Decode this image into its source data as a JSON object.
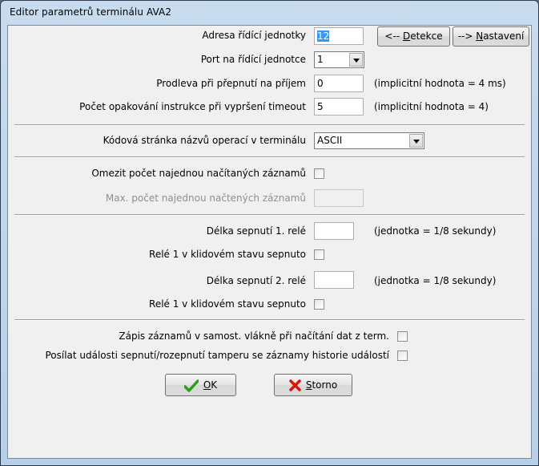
{
  "window": {
    "title": "Editor parametrů terminálu AVA2"
  },
  "fields": {
    "address_label": "Adresa řídící jednotky",
    "address_value": "12",
    "detect_prefix": "<-- ",
    "detect_key": "D",
    "detect_rest": "etekce",
    "setup_prefix": "--> ",
    "setup_key": "N",
    "setup_rest": "astavení",
    "port_label": "Port na řídící jednotce",
    "port_value": "1",
    "delay_label": "Prodleva při přepnutí na příjem",
    "delay_value": "0",
    "delay_note": "(implicitní hodnota = 4 ms)",
    "retry_label": "Počet opakování instrukce při vypršení timeout",
    "retry_value": "5",
    "retry_note": "(implicitní hodnota = 4)",
    "codepage_label": "Kódová stránka názvů operací v terminálu",
    "codepage_value": "ASCII",
    "limit_label": "Omezit počet najednou načítaných záznamů",
    "max_label": "Max. počet najednou načtených záznamů",
    "max_value": "",
    "relay1_label": "Délka sepnutí 1. relé",
    "relay1_value": "",
    "relay1_note": "(jednotka = 1/8 sekundy)",
    "relay1_idle_label": "Relé 1 v klidovém stavu sepnuto",
    "relay2_label": "Délka sepnutí 2. relé",
    "relay2_value": "",
    "relay2_note": "(jednotka = 1/8 sekundy)",
    "relay2_idle_label": "Relé 1 v klidovém stavu sepnuto",
    "thread_label": "Zápis záznamů v samost. vlákně při načítání dat z term.",
    "tamper_label": "Posílat události sepnutí/rozepnutí tamperu se záznamy historie událostí"
  },
  "buttons": {
    "ok_key": "O",
    "ok_rest": "K",
    "cancel_key": "S",
    "cancel_rest": "torno"
  },
  "colors": {
    "ok_icon": "#2e9c1c",
    "cancel_icon": "#d11a0f"
  }
}
